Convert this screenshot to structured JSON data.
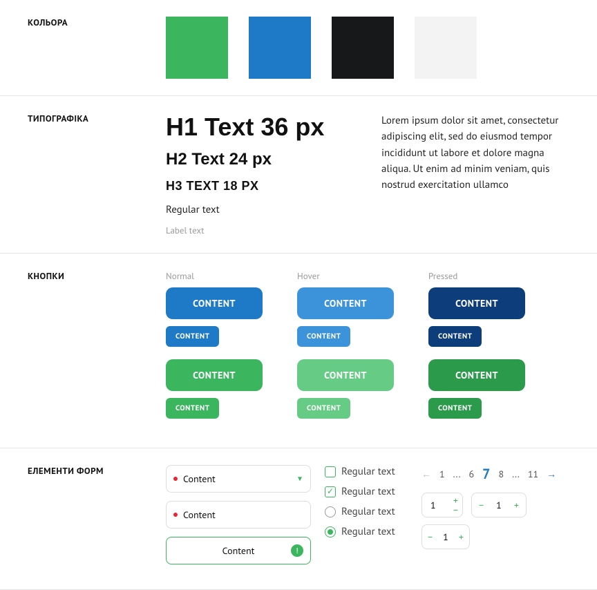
{
  "sections": {
    "colors": {
      "label": "КОЛЬОРА"
    },
    "typography": {
      "label": "ТИПОГРАФІКА"
    },
    "buttons": {
      "label": "КНОПКИ"
    },
    "forms": {
      "label": "ЕЛЕМЕНТИ ФОРМ"
    }
  },
  "colors": {
    "swatches": [
      "#3cb55f",
      "#1e7ac7",
      "#17181a",
      "#f3f3f3"
    ]
  },
  "typography": {
    "h1": "H1 Text 36 px",
    "h2": "H2 Text 24 px",
    "h3": "H3 TEXT 18 PX",
    "regular": "Regular text",
    "label": "Label text",
    "paragraph": "Lorem ipsum dolor sit amet, consectetur adipiscing elit, sed do eiusmod tempor incididunt ut labore et dolore magna aliqua. Ut enim ad minim veniam, quis nostrud exercitation ullamco"
  },
  "buttons": {
    "states": {
      "normal": "Normal",
      "hover": "Hover",
      "pressed": "Pressed"
    },
    "label": "CONTENT"
  },
  "forms": {
    "input1": "Content",
    "input2": "Content",
    "input3": "Content",
    "check_label": "Regular text",
    "pagination": {
      "pages": [
        "1",
        "...",
        "6",
        "7",
        "8",
        "...",
        "11"
      ],
      "current": "7"
    },
    "stepper_value": "1"
  }
}
